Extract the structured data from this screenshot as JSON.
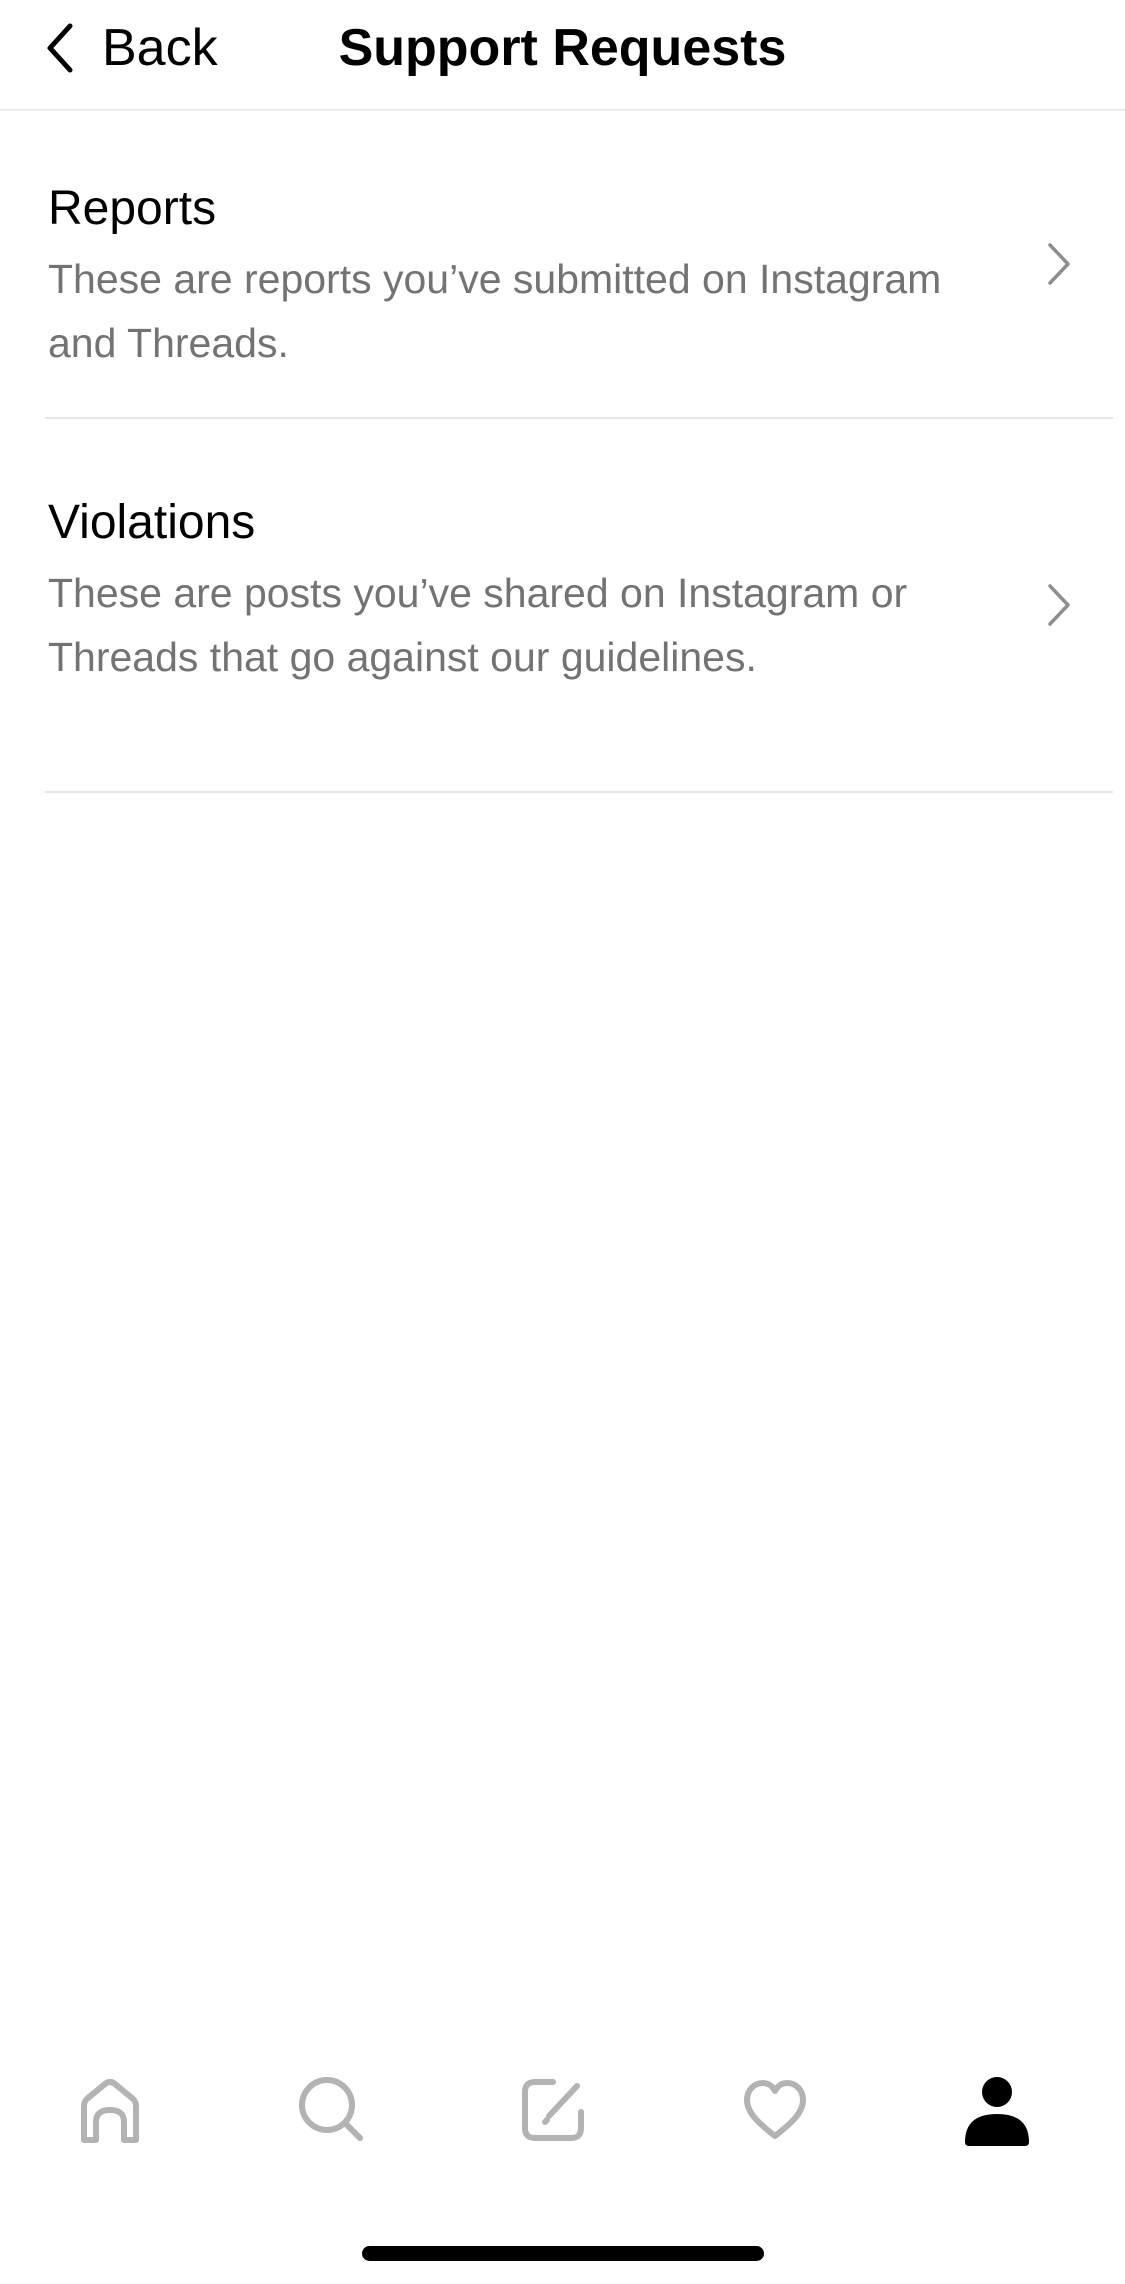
{
  "header": {
    "back_label": "Back",
    "title": "Support Requests"
  },
  "list": {
    "items": [
      {
        "title": "Reports",
        "description": "These are reports you’ve submitted on Instagram and Threads."
      },
      {
        "title": "Violations",
        "description": "These are posts you’ve shared on Instagram or Threads that go against our guidelines."
      }
    ]
  },
  "tabbar": {
    "tabs": [
      {
        "icon": "home-icon",
        "active": false
      },
      {
        "icon": "search-icon",
        "active": false
      },
      {
        "icon": "compose-icon",
        "active": false
      },
      {
        "icon": "heart-icon",
        "active": false
      },
      {
        "icon": "profile-icon",
        "active": true
      }
    ]
  },
  "colors": {
    "text_primary": "#000000",
    "text_secondary": "#737373",
    "icon_inactive": "#b3b3b3",
    "divider": "#e6e6e6"
  }
}
